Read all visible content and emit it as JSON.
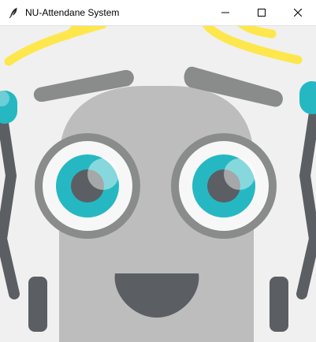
{
  "window": {
    "title": "NU-Attendane System",
    "app_icon": "feather-icon",
    "controls": [
      "minimize-icon",
      "maximize-icon",
      "close-icon"
    ]
  },
  "canvas": {
    "content": "robot-mascot-illustration",
    "colors": {
      "background": "#f0f0f0",
      "head": "#bdbdbd",
      "eyebrow": "#898c8a",
      "eye_ring": "#898c8a",
      "iris": "#26b8c2",
      "pupil": "#5b5f63",
      "mouth": "#5b5f63",
      "antenna_spark": "#fde74c",
      "arm": "#5b5f63",
      "antenna_ball": "#26b8c2"
    }
  }
}
